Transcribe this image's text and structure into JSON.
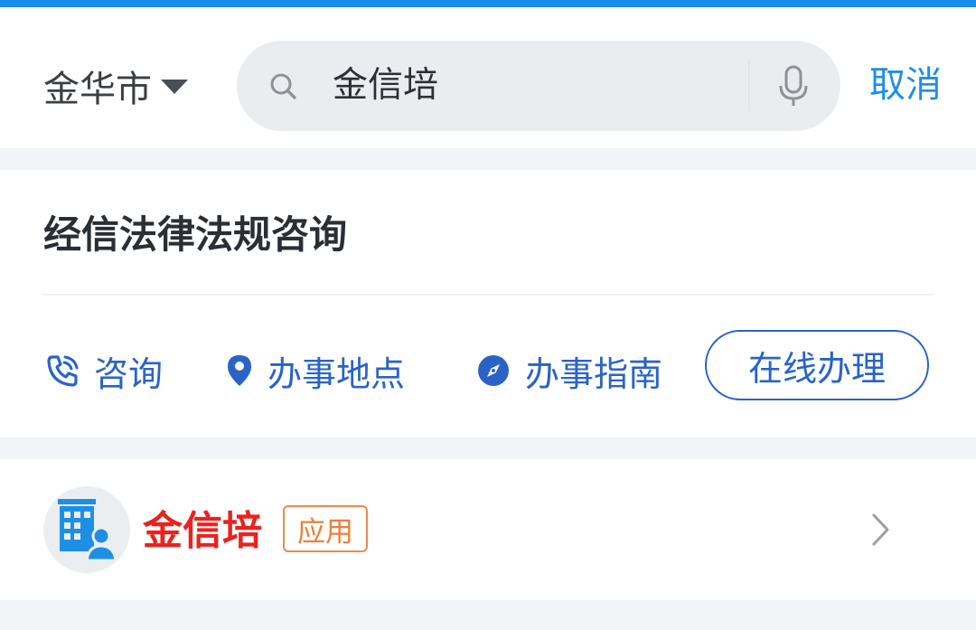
{
  "header": {
    "city": "金华市",
    "search_value": "金信培",
    "cancel_label": "取消"
  },
  "service_card": {
    "title": "经信法律法规咨询",
    "actions": [
      {
        "label": "咨询",
        "icon": "phone-icon"
      },
      {
        "label": "办事地点",
        "icon": "location-pin-icon"
      },
      {
        "label": "办事指南",
        "icon": "compass-icon"
      }
    ],
    "online_button": "在线办理"
  },
  "app_result": {
    "name": "金信培",
    "tag": "应用",
    "icon": "building-user-icon"
  },
  "colors": {
    "accent_top_bar": "#1a8cf0",
    "cancel_blue": "#1e8ee8",
    "action_blue": "#2a63c8",
    "app_name_red": "#e8231f",
    "tag_orange": "#ec7f3a"
  }
}
